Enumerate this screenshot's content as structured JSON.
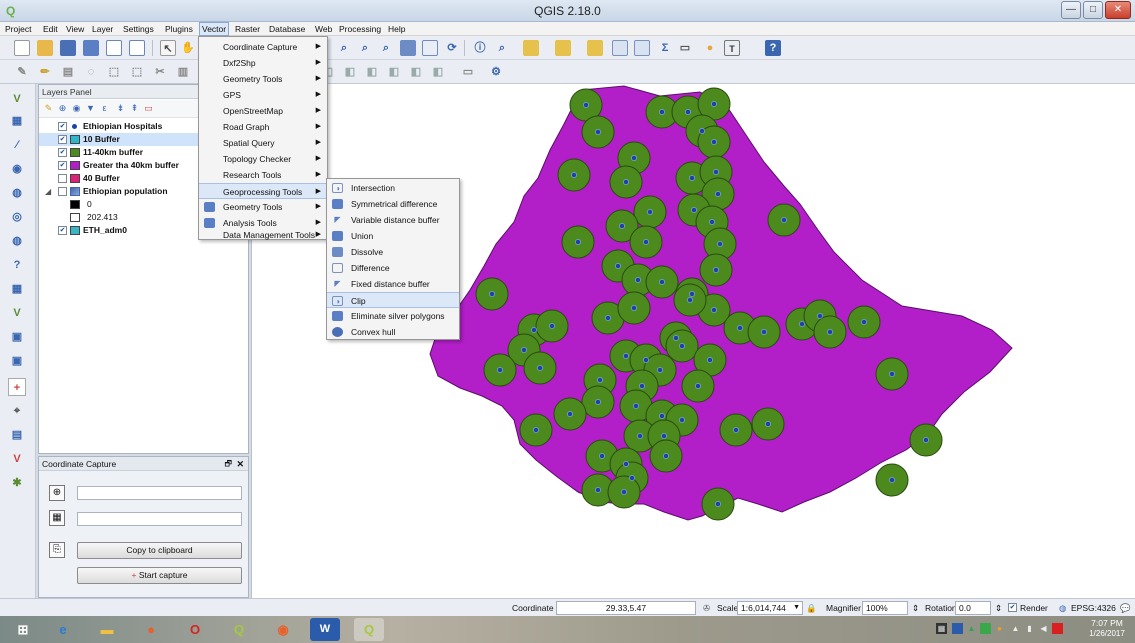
{
  "window": {
    "title": "QGIS 2.18.0",
    "minimize": "—",
    "maximize": "□",
    "close": "✕"
  },
  "menubar": [
    "Project",
    "Edit",
    "View",
    "Layer",
    "Settings",
    "Plugins",
    "Vector",
    "Raster",
    "Database",
    "Web",
    "Processing",
    "Help"
  ],
  "vector_menu": {
    "items": [
      "Coordinate Capture",
      "Dxf2Shp",
      "Geometry Tools",
      "GPS",
      "OpenStreetMap",
      "Road Graph",
      "Spatial Query",
      "Topology Checker",
      "Research Tools",
      "Geoprocessing Tools",
      "Geometry Tools",
      "Analysis Tools",
      "Data Management Tools"
    ],
    "highlighted": "Geoprocessing Tools"
  },
  "geoprocessing_submenu": {
    "items": [
      "Intersection",
      "Symmetrical difference",
      "Variable distance buffer",
      "Union",
      "Dissolve",
      "Difference",
      "Fixed distance buffer",
      "Clip",
      "Eliminate silver polygons",
      "Convex hull"
    ],
    "highlighted": "Clip"
  },
  "layers_panel": {
    "title": "Layers Panel",
    "layers": [
      {
        "label": "Ethiopian Hospitals",
        "checked": true,
        "symbol": "point",
        "color": "#1f3fae"
      },
      {
        "label": "10 Buffer",
        "checked": true,
        "symbol": "fill",
        "color": "#2db8c8",
        "selected": true
      },
      {
        "label": "11-40km buffer",
        "checked": true,
        "symbol": "fill",
        "color": "#4c8a1e"
      },
      {
        "label": "Greater tha 40km buffer",
        "checked": true,
        "symbol": "fill",
        "color": "#b21ec8"
      },
      {
        "label": "40 Buffer",
        "checked": false,
        "symbol": "fill",
        "color": "#e0207a"
      },
      {
        "label": "Ethiopian population",
        "checked": false,
        "symbol": "raster",
        "color": "#4466aa"
      },
      {
        "label": "0",
        "legend": true,
        "color": "#000000"
      },
      {
        "label": "202.413",
        "legend": true,
        "color": "#ffffff"
      },
      {
        "label": "ETH_adm0",
        "checked": true,
        "symbol": "fill",
        "color": "#35b8c4"
      }
    ]
  },
  "coordinate_capture": {
    "title": "Coordinate Capture",
    "copy_button": "Copy to clipboard",
    "start_button": "Start capture"
  },
  "statusbar": {
    "coordinate_label": "Coordinate",
    "coordinate_value": "29.33,5.47",
    "scale_label": "Scale",
    "scale_value": "1:6,014,744",
    "magnifier_label": "Magnifier",
    "magnifier_value": "100%",
    "rotation_label": "Rotation",
    "rotation_value": "0.0",
    "render_label": "Render",
    "crs": "EPSG:4326"
  },
  "taskbar": {
    "time": "7:07 PM",
    "date": "1/26/2017"
  },
  "colors": {
    "country_fill": "#b21ec8",
    "buffer_fill": "#4c8a1e",
    "hospital_point": "#1f3fae",
    "menu_highlight": "#dce8f8"
  }
}
